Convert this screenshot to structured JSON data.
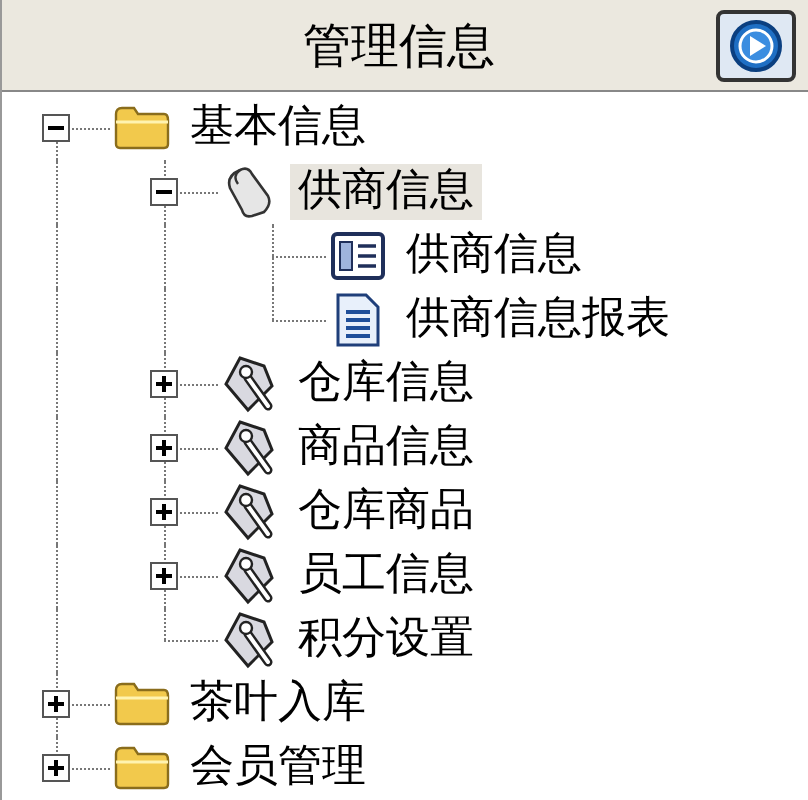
{
  "header": {
    "title": "管理信息"
  },
  "tree": [
    {
      "label": "基本信息",
      "kind": "folder",
      "expanded": true,
      "selected": false,
      "children": [
        {
          "label": "供商信息",
          "kind": "scroll",
          "expanded": true,
          "selected": true,
          "children": [
            {
              "label": "供商信息",
              "kind": "form",
              "selected": false
            },
            {
              "label": "供商信息报表",
              "kind": "document",
              "selected": false
            }
          ]
        },
        {
          "label": "仓库信息",
          "kind": "tool",
          "expanded": false,
          "selected": false
        },
        {
          "label": "商品信息",
          "kind": "tool",
          "expanded": false,
          "selected": false
        },
        {
          "label": "仓库商品",
          "kind": "tool",
          "expanded": false,
          "selected": false
        },
        {
          "label": "员工信息",
          "kind": "tool",
          "expanded": false,
          "selected": false
        },
        {
          "label": "积分设置",
          "kind": "tool",
          "selected": false
        }
      ]
    },
    {
      "label": "茶叶入库",
      "kind": "folder",
      "expanded": false,
      "selected": false
    },
    {
      "label": "会员管理",
      "kind": "folder",
      "expanded": false,
      "selected": false
    }
  ]
}
